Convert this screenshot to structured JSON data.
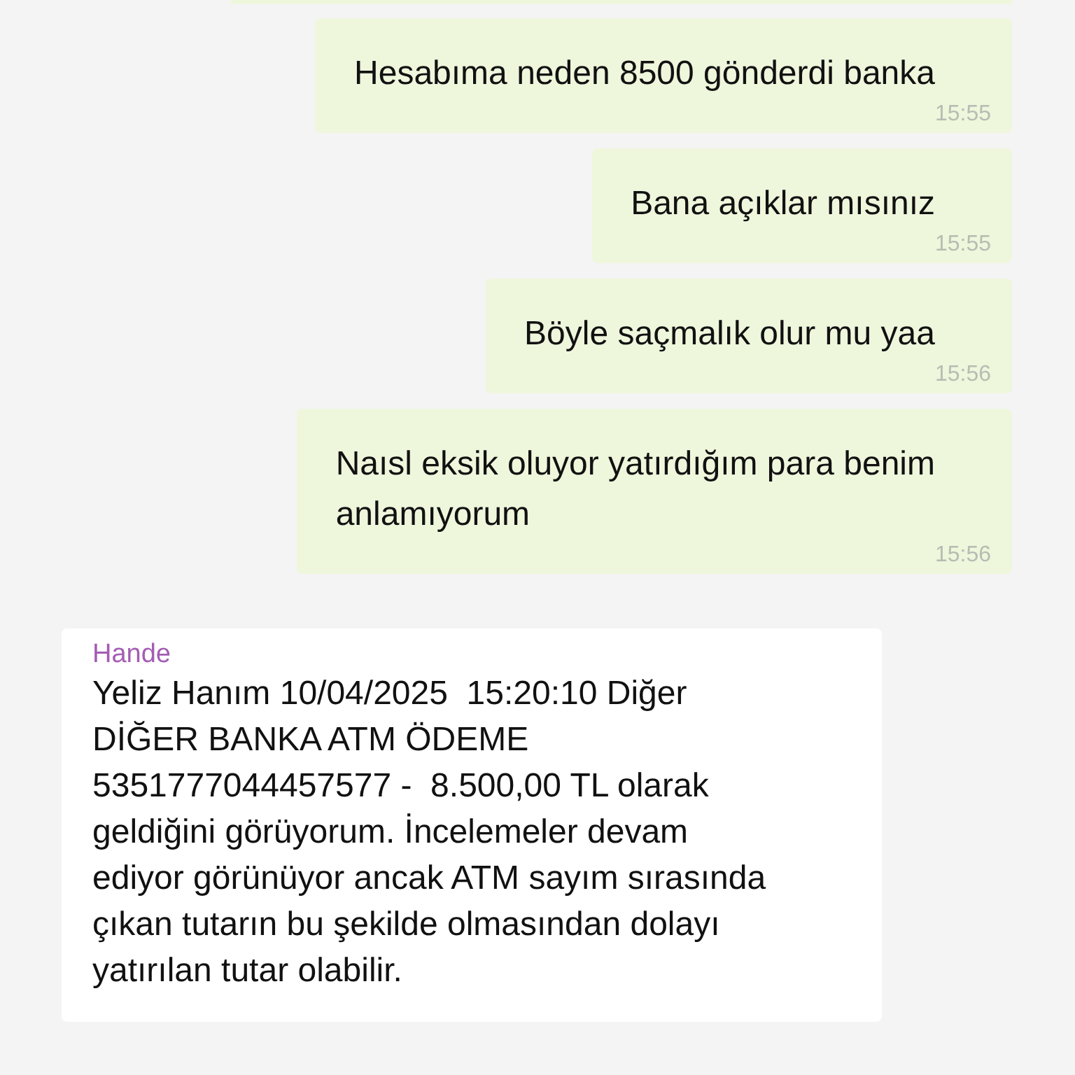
{
  "messages": [
    {
      "kind": "outgoing",
      "text": "Hesabıma neden 8500 gönderdi banka",
      "time": "15:55"
    },
    {
      "kind": "outgoing",
      "text": "Bana açıklar mısınız",
      "time": "15:55"
    },
    {
      "kind": "outgoing",
      "text": "Böyle saçmalık olur mu yaa",
      "time": "15:56"
    },
    {
      "kind": "outgoing",
      "text": "Naısl eksik oluyor yatırdığım para benim\nanlamıyorum",
      "time": "15:56"
    },
    {
      "kind": "incoming",
      "sender": "Hande",
      "text": "Yeliz Hanım 10/04/2025  15:20:10 Diğer\nDİĞER BANKA ATM ÖDEME\n5351777044457577 -  8.500,00 TL olarak\ngeldiğini görüyorum. İncelemeler devam\nediyor görünüyor ancak ATM sayım sırasında\nçıkan tutarın bu şekilde olmasından dolayı\nyatırılan tutar olabilir."
    }
  ]
}
